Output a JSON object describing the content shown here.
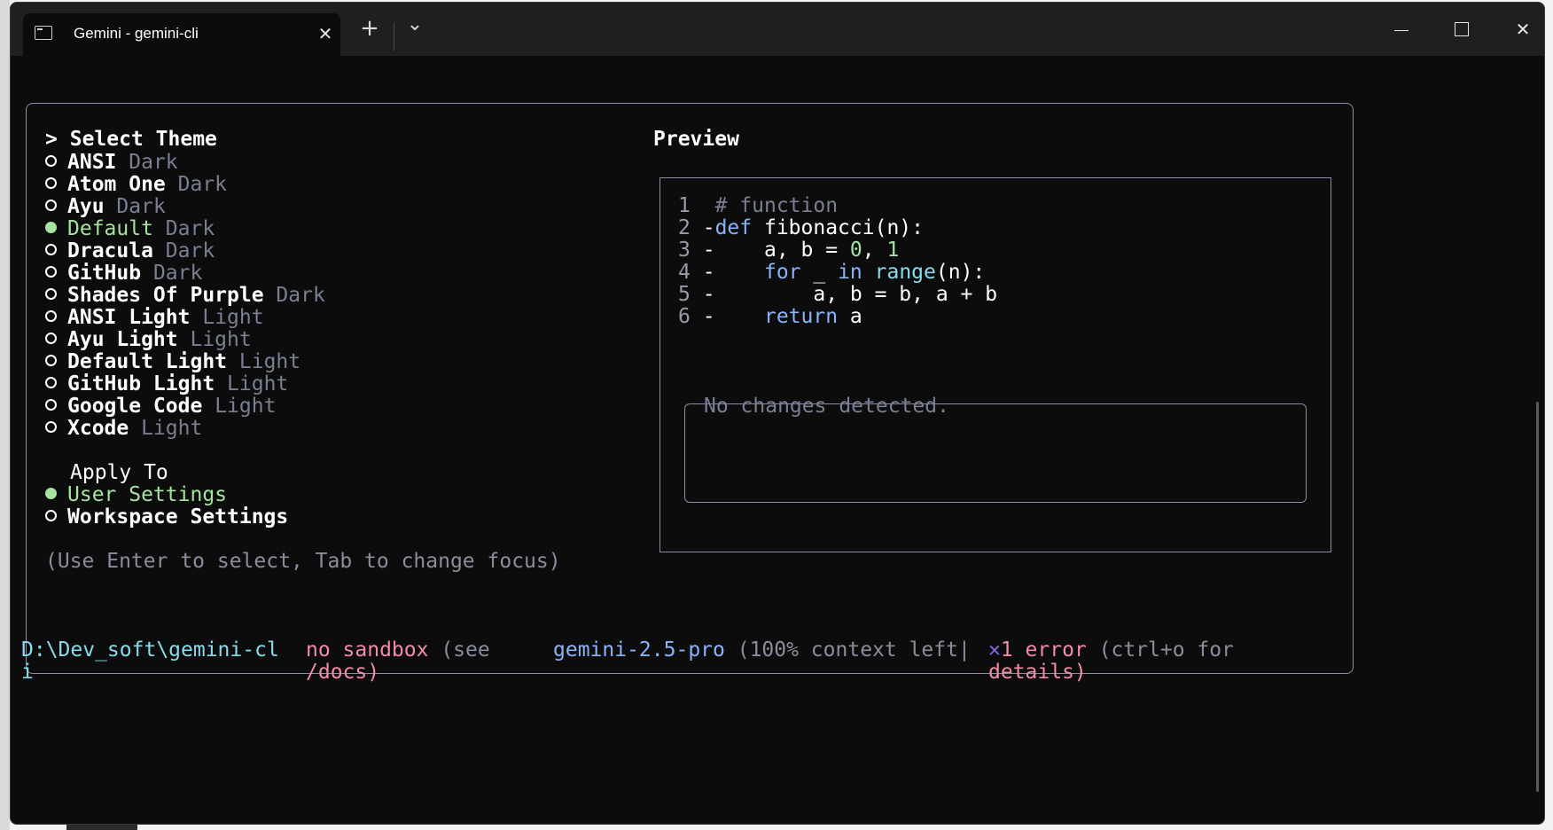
{
  "window": {
    "tab_title": "Gemini - gemini-cli",
    "new_tab_symbol": "+",
    "dropdown_symbol": "⌄",
    "close_tab_symbol": "✕",
    "minimize_symbol": "─",
    "close_symbol": "✕"
  },
  "dialog": {
    "prompt": ">",
    "title": "Select Theme",
    "themes": [
      {
        "name": "ANSI",
        "type": "Dark",
        "selected": false
      },
      {
        "name": "Atom One",
        "type": "Dark",
        "selected": false
      },
      {
        "name": "Ayu",
        "type": "Dark",
        "selected": false
      },
      {
        "name": "Default",
        "type": "Dark",
        "selected": true
      },
      {
        "name": "Dracula",
        "type": "Dark",
        "selected": false
      },
      {
        "name": "GitHub",
        "type": "Dark",
        "selected": false
      },
      {
        "name": "Shades Of Purple",
        "type": "Dark",
        "selected": false
      },
      {
        "name": "ANSI Light",
        "type": "Light",
        "selected": false
      },
      {
        "name": "Ayu Light",
        "type": "Light",
        "selected": false
      },
      {
        "name": "Default Light",
        "type": "Light",
        "selected": false
      },
      {
        "name": "GitHub Light",
        "type": "Light",
        "selected": false
      },
      {
        "name": "Google Code",
        "type": "Light",
        "selected": false
      },
      {
        "name": "Xcode",
        "type": "Light",
        "selected": false
      }
    ],
    "apply_to_label": "Apply To",
    "scopes": [
      {
        "name": "User Settings",
        "selected": true
      },
      {
        "name": "Workspace Settings",
        "selected": false
      }
    ],
    "hint": "(Use Enter to select, Tab to change focus)",
    "preview": {
      "title": "Preview",
      "code_lines": [
        {
          "num": "1",
          "marker": " ",
          "indent": "",
          "tokens": [
            {
              "t": "# function",
              "c": "gray"
            }
          ]
        },
        {
          "num": "2",
          "marker": "-",
          "indent": "",
          "tokens": [
            {
              "t": "def",
              "c": "blue"
            },
            {
              "t": " fibonacci(n):",
              "c": "w"
            }
          ]
        },
        {
          "num": "3",
          "marker": "-",
          "indent": "    ",
          "tokens": [
            {
              "t": "a, b = ",
              "c": "w"
            },
            {
              "t": "0",
              "c": "num"
            },
            {
              "t": ", ",
              "c": "w"
            },
            {
              "t": "1",
              "c": "num"
            }
          ]
        },
        {
          "num": "4",
          "marker": "-",
          "indent": "    ",
          "tokens": [
            {
              "t": "for",
              "c": "blue"
            },
            {
              "t": " _ ",
              "c": "w"
            },
            {
              "t": "in",
              "c": "blue"
            },
            {
              "t": " ",
              "c": "w"
            },
            {
              "t": "range",
              "c": "cyan"
            },
            {
              "t": "(n):",
              "c": "w"
            }
          ]
        },
        {
          "num": "5",
          "marker": "-",
          "indent": "        ",
          "tokens": [
            {
              "t": "a, b = b, a + b",
              "c": "w"
            }
          ]
        },
        {
          "num": "6",
          "marker": "-",
          "indent": "    ",
          "tokens": [
            {
              "t": "return",
              "c": "blue"
            },
            {
              "t": " a",
              "c": "w"
            }
          ]
        }
      ],
      "diff_message": "No changes detected."
    }
  },
  "footer": {
    "path_line1": "D:\\Dev_soft\\gemini-cl",
    "path_line2": "i",
    "sandbox": "no sandbox",
    "sandbox_hint1": " (see",
    "sandbox_hint2": "/docs)",
    "model": "gemini-2.5-pro",
    "context": " (100% context left|",
    "error_icon": "✕",
    "error_text": "1 error",
    "error_hint1": " (ctrl+o for",
    "error_hint2": "details)"
  }
}
